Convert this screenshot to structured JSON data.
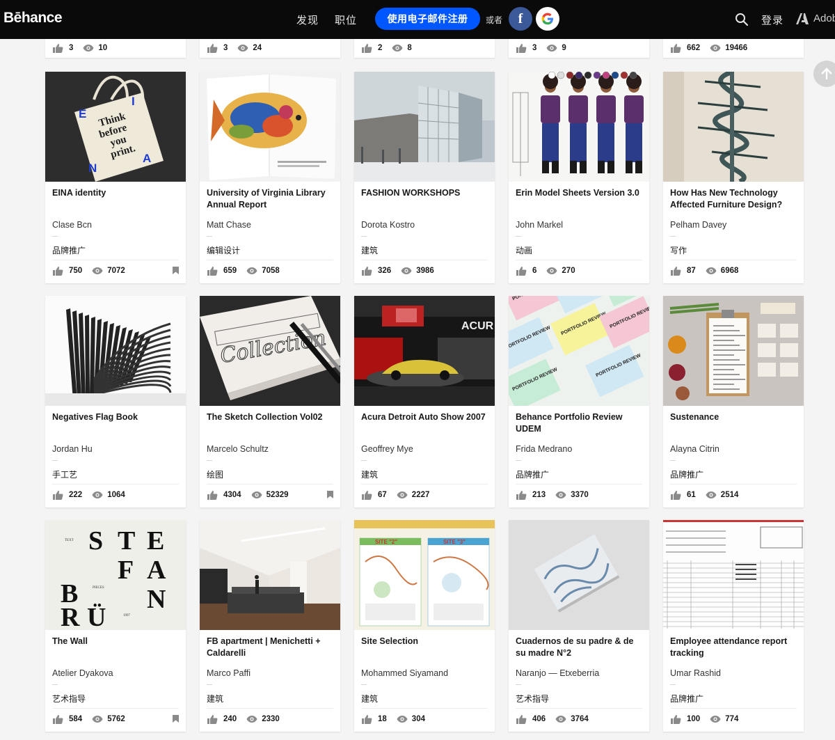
{
  "header": {
    "logo": "Bēhance",
    "nav_discover": "发现",
    "nav_jobs": "职位",
    "signup_label": "使用电子邮件注册",
    "or_label": "或者",
    "facebook_glyph": "f",
    "login_label": "登录",
    "adobe_label": "Adobe"
  },
  "top_partial": [
    {
      "appreciations": "3",
      "views": "10"
    },
    {
      "appreciations": "3",
      "views": "24"
    },
    {
      "appreciations": "2",
      "views": "8"
    },
    {
      "appreciations": "3",
      "views": "9"
    },
    {
      "appreciations": "662",
      "views": "19466"
    }
  ],
  "projects": [
    {
      "title": "EINA identity",
      "owner": "Clase Bcn",
      "field": "品牌推广",
      "appreciations": "750",
      "views": "7072",
      "bookmark": true,
      "thumb": "tote-bag"
    },
    {
      "title": "University of Virginia Library Annual Report",
      "owner": "Matt Chase",
      "field": "编辑设计",
      "appreciations": "659",
      "views": "7058",
      "bookmark": false,
      "thumb": "fish-book"
    },
    {
      "title": "FASHION WORKSHOPS",
      "owner": "Dorota Kostro",
      "field": "建筑",
      "appreciations": "326",
      "views": "3986",
      "bookmark": false,
      "thumb": "glass-building"
    },
    {
      "title": "Erin Model Sheets Version 3.0",
      "owner": "John Markel",
      "field": "动画",
      "appreciations": "6",
      "views": "270",
      "bookmark": false,
      "thumb": "character-sheet"
    },
    {
      "title": "How Has New Technology Affected Furniture Design?",
      "owner": "Pelham Davey",
      "field": "写作",
      "appreciations": "87",
      "views": "6968",
      "bookmark": false,
      "thumb": "spiral-stair"
    },
    {
      "title": "Negatives Flag Book",
      "owner": "Jordan Hu",
      "field": "手工艺",
      "appreciations": "222",
      "views": "1064",
      "bookmark": false,
      "thumb": "flag-book"
    },
    {
      "title": "The Sketch Collection Vol02",
      "owner": "Marcelo Schultz",
      "field": "绘图",
      "appreciations": "4304",
      "views": "52329",
      "bookmark": true,
      "thumb": "sketch-lettering"
    },
    {
      "title": "Acura Detroit Auto Show 2007",
      "owner": "Geoffrey Mye",
      "field": "建筑",
      "appreciations": "67",
      "views": "2227",
      "bookmark": false,
      "thumb": "auto-show"
    },
    {
      "title": "Behance Portfolio Review UDEM",
      "owner": "Frida Medrano",
      "field": "品牌推广",
      "appreciations": "213",
      "views": "3370",
      "bookmark": false,
      "thumb": "portfolio-cards"
    },
    {
      "title": "Sustenance",
      "owner": "Alayna Citrin",
      "field": "品牌推广",
      "appreciations": "61",
      "views": "2514",
      "bookmark": false,
      "thumb": "menu-flatlay"
    },
    {
      "title": "The Wall",
      "owner": "Atelier Dyakova",
      "field": "艺术指导",
      "appreciations": "584",
      "views": "5762",
      "bookmark": true,
      "thumb": "typography-poster"
    },
    {
      "title": "FB apartment | Menichetti + Caldarelli",
      "owner": "Marco Paffi",
      "field": "建筑",
      "appreciations": "240",
      "views": "2330",
      "bookmark": false,
      "thumb": "apartment"
    },
    {
      "title": "Site Selection",
      "owner": "Mohammed Siyamand",
      "field": "建筑",
      "appreciations": "18",
      "views": "304",
      "bookmark": false,
      "thumb": "site-boards"
    },
    {
      "title": "Cuadernos de su padre & de su madre N°2",
      "owner": "Naranjo — Etxeberria",
      "field": "艺术指导",
      "appreciations": "406",
      "views": "3764",
      "bookmark": false,
      "thumb": "notebook"
    },
    {
      "title": "Employee attendance report tracking",
      "owner": "Umar Rashid",
      "field": "品牌推广",
      "appreciations": "100",
      "views": "774",
      "bookmark": false,
      "thumb": "attendance-form"
    }
  ],
  "thumb_text": {
    "tote_lines": [
      "Think",
      "before",
      "you",
      "print."
    ],
    "tote_letters": [
      "E",
      "I",
      "N",
      "A"
    ],
    "sketch_title": "Collection",
    "acura_sign": "ACUR",
    "portfolio_label": "PORTFOLIO REVIEW",
    "wall_letters": [
      "S",
      "T",
      "E",
      "F",
      "A",
      "B",
      "N",
      "R",
      "Ü"
    ],
    "wall_small": [
      "TEXT",
      "PIECES",
      "1997"
    ],
    "site_labels": [
      "SITE \"2\"",
      "SITE \"3\""
    ]
  },
  "colors": {
    "accent": "#0057ff",
    "topbar": "#0a0a0a",
    "background": "#f4f4f4",
    "facebook": "#3b5998"
  }
}
